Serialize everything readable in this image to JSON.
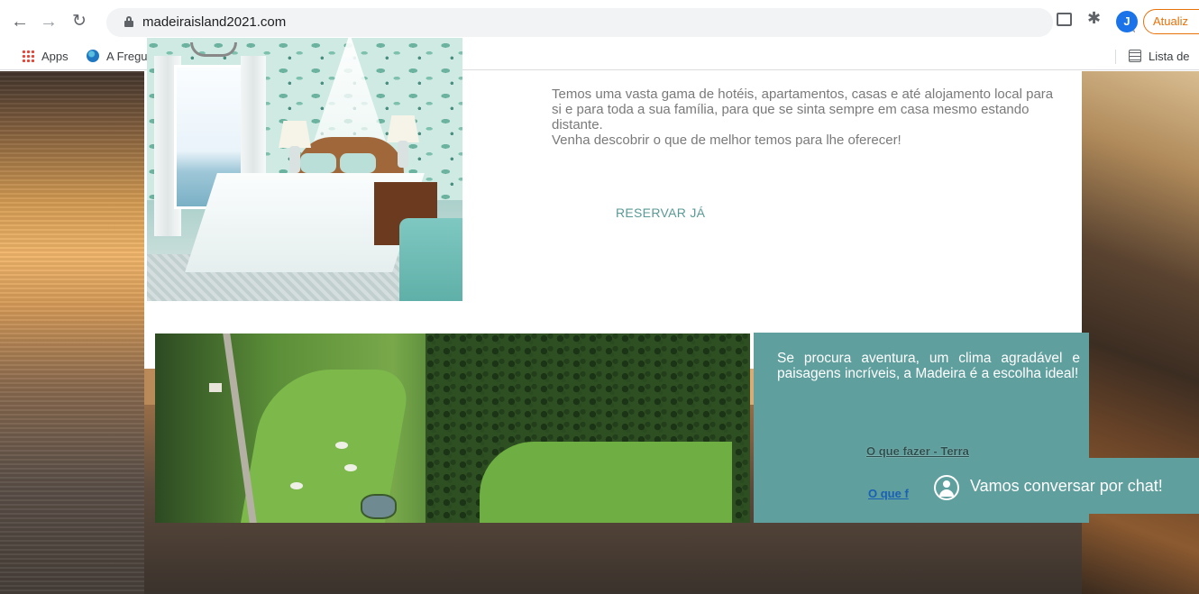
{
  "browser": {
    "url": "madeiraisland2021.com",
    "avatar_initial": "J",
    "update_label": "Atualiz",
    "bookmarks": [
      {
        "label": "Apps"
      },
      {
        "label": "A Freguesia"
      }
    ],
    "reading_list_label": "Lista de"
  },
  "hotel_section": {
    "description": "Temos uma vasta gama de hotéis, apartamentos, casas e até alojamento local para si e para toda a sua família, para que se sinta sempre em casa mesmo estando distante.",
    "cta_text": "Venha descobrir o que de melhor temos para lhe oferecer!",
    "reserve_label": "RESERVAR JÁ"
  },
  "adventure_section": {
    "text": "Se procura aventura, um clima agradável e paisagens incríveis, a Madeira é a escolha ideal!",
    "link_land": "O que fazer - Terra",
    "link_partial": "O que f"
  },
  "chat": {
    "label": "Vamos conversar por chat!"
  },
  "colors": {
    "teal": "#5f9f9d",
    "update_orange": "#e8710a",
    "avatar_blue": "#1a73e8"
  }
}
